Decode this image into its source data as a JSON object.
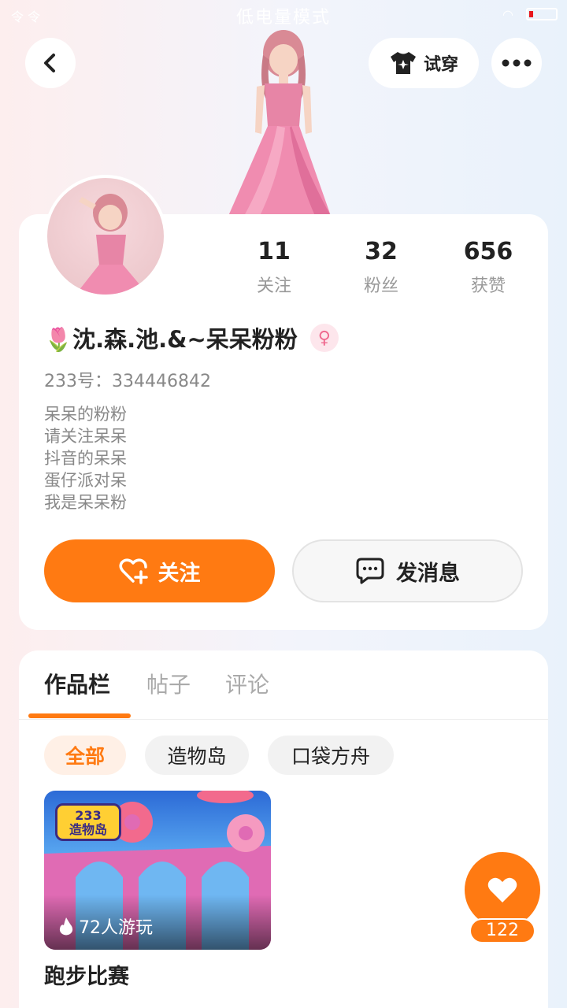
{
  "status_bar": {
    "mode_text": "低电量模式",
    "left_text": "令 令"
  },
  "header": {
    "tryon_label": "试穿"
  },
  "stats": [
    {
      "value": "11",
      "label": "关注"
    },
    {
      "value": "32",
      "label": "粉丝"
    },
    {
      "value": "656",
      "label": "获赞"
    }
  ],
  "profile": {
    "username": "🌷沈.森.池.&~呆呆粉粉",
    "gender_symbol": "♀",
    "uid": "233号：334446842",
    "bio": [
      "呆呆的粉粉",
      "请关注呆呆",
      "抖音的呆呆",
      "蛋仔派对呆",
      "我是呆呆粉"
    ]
  },
  "actions": {
    "follow_label": "关注",
    "message_label": "发消息"
  },
  "tabs": [
    "作品栏",
    "帖子",
    "评论"
  ],
  "filters": [
    "全部",
    "造物岛",
    "口袋方舟"
  ],
  "works": [
    {
      "logo_top": "233",
      "logo_bottom": "造物岛",
      "players": "72人游玩",
      "title": "跑步比赛"
    }
  ],
  "like": {
    "count": "122"
  },
  "colors": {
    "accent": "#ff7a12",
    "gender": "#ef6a8f"
  }
}
